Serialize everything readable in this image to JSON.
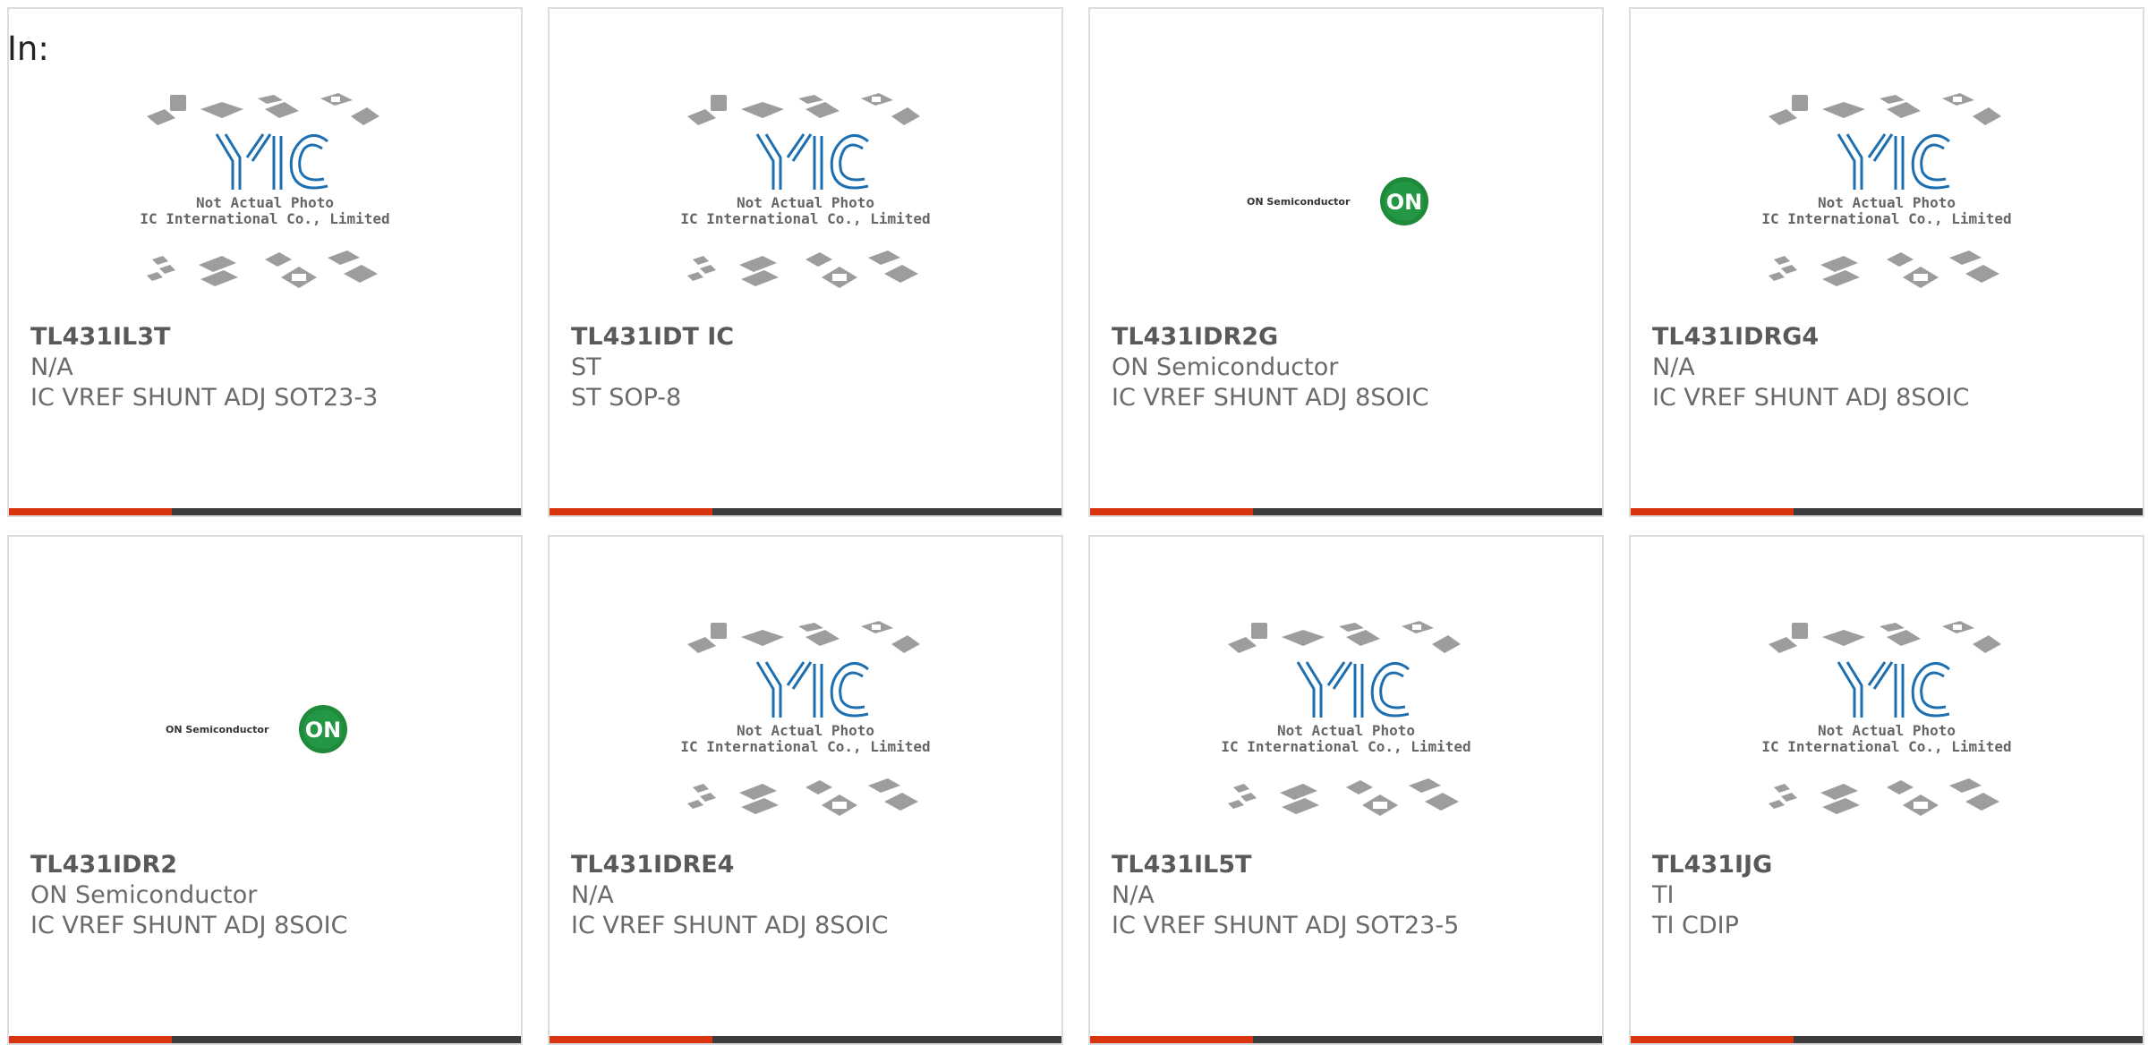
{
  "page": {
    "label": "In:"
  },
  "colors": {
    "accent": "#d8340f",
    "bar_dark": "#3c3c3c",
    "card_border": "#dcdcdc",
    "on_green": "#1f8a3a"
  },
  "placeholder_image": {
    "icon": "yic-placeholder-icon",
    "caption_line1": "Not Actual Photo",
    "caption_line2": "YIC International Co., Limited."
  },
  "on_logo": {
    "icon": "on-semiconductor-logo",
    "wordmark": "ON Semiconductor",
    "badge": "ON"
  },
  "products": [
    {
      "part_number": "TL431IL3T",
      "manufacturer": "N/A",
      "description": "IC VREF SHUNT ADJ SOT23-3",
      "image": "yic-placeholder"
    },
    {
      "part_number": "TL431IDT IC",
      "manufacturer": "ST",
      "description": "ST SOP-8",
      "image": "yic-placeholder"
    },
    {
      "part_number": "TL431IDR2G",
      "manufacturer": "ON Semiconductor",
      "description": "IC VREF SHUNT ADJ 8SOIC",
      "image": "on-semiconductor-logo"
    },
    {
      "part_number": "TL431IDRG4",
      "manufacturer": "N/A",
      "description": "IC VREF SHUNT ADJ 8SOIC",
      "image": "yic-placeholder"
    },
    {
      "part_number": "TL431IDR2",
      "manufacturer": "ON Semiconductor",
      "description": "IC VREF SHUNT ADJ 8SOIC",
      "image": "on-semiconductor-logo"
    },
    {
      "part_number": "TL431IDRE4",
      "manufacturer": "N/A",
      "description": "IC VREF SHUNT ADJ 8SOIC",
      "image": "yic-placeholder"
    },
    {
      "part_number": "TL431IL5T",
      "manufacturer": "N/A",
      "description": "IC VREF SHUNT ADJ SOT23-5",
      "image": "yic-placeholder"
    },
    {
      "part_number": "TL431IJG",
      "manufacturer": "TI",
      "description": "TI CDIP",
      "image": "yic-placeholder"
    }
  ]
}
